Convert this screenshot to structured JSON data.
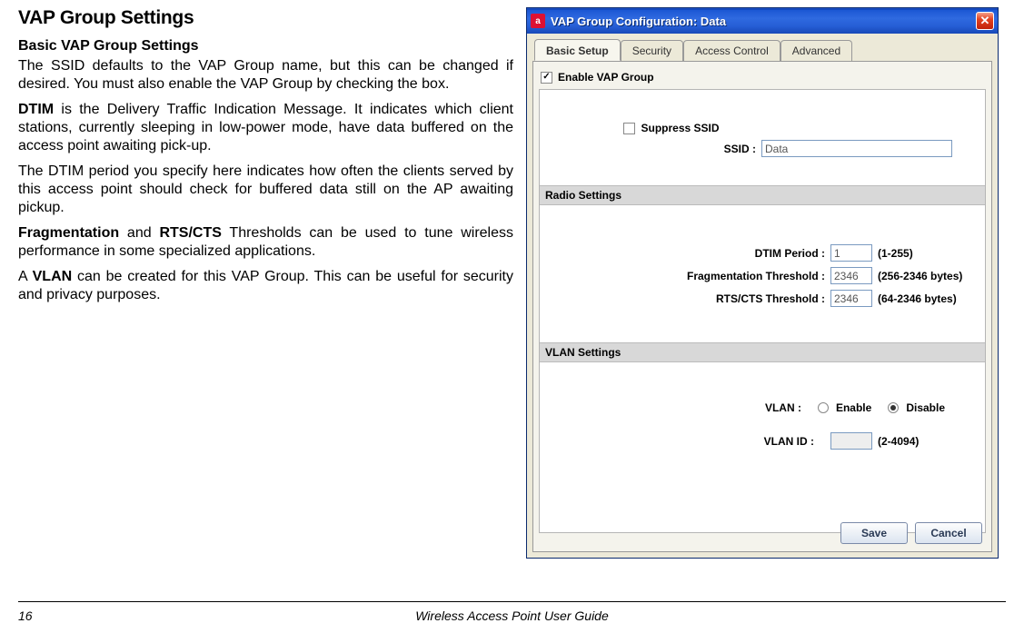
{
  "doc": {
    "h1": "VAP Group Settings",
    "h2": "Basic VAP Group Settings",
    "p1a": "The SSID defaults to the VAP Group name, but this can be changed if desired. You must also enable the VAP Group by checking the box.",
    "p2_b": "DTIM",
    "p2a": " is the Delivery Traffic Indication Message. It indicates which client stations, currently sleeping in low-power mode, have data buffered on the access point awaiting pick-up.",
    "p3": "The DTIM period you specify here indicates how often the clients served by this access point should check for buffered data still on the AP awaiting pickup.",
    "p4_b1": "Fragmentation",
    "p4_mid": " and ",
    "p4_b2": "RTS/CTS",
    "p4_end": " Thresholds can be used to tune wireless performance in some specialized applications.",
    "p5_pre": "A ",
    "p5_b": "VLAN",
    "p5_end": " can be created for this VAP Group. This can be useful for security and privacy purposes."
  },
  "footer": {
    "page": "16",
    "title": "Wireless Access Point User Guide"
  },
  "dlg": {
    "title": "VAP Group Configuration: Data",
    "tabs": {
      "basic": "Basic Setup",
      "security": "Security",
      "access": "Access Control",
      "advanced": "Advanced"
    },
    "enable_label": "Enable VAP Group",
    "suppress_label": "Suppress SSID",
    "ssid_label": "SSID :",
    "ssid_value": "Data",
    "radio_header": "Radio Settings",
    "dtim_label": "DTIM Period :",
    "dtim_value": "1",
    "dtim_hint": "(1-255)",
    "frag_label": "Fragmentation Threshold :",
    "frag_value": "2346",
    "frag_hint": "(256-2346 bytes)",
    "rts_label": "RTS/CTS Threshold :",
    "rts_value": "2346",
    "rts_hint": "(64-2346 bytes)",
    "vlan_header": "VLAN Settings",
    "vlan_label": "VLAN :",
    "vlan_enable": "Enable",
    "vlan_disable": "Disable",
    "vlanid_label": "VLAN ID :",
    "vlanid_value": "",
    "vlanid_hint": "(2-4094)",
    "save": "Save",
    "cancel": "Cancel"
  }
}
